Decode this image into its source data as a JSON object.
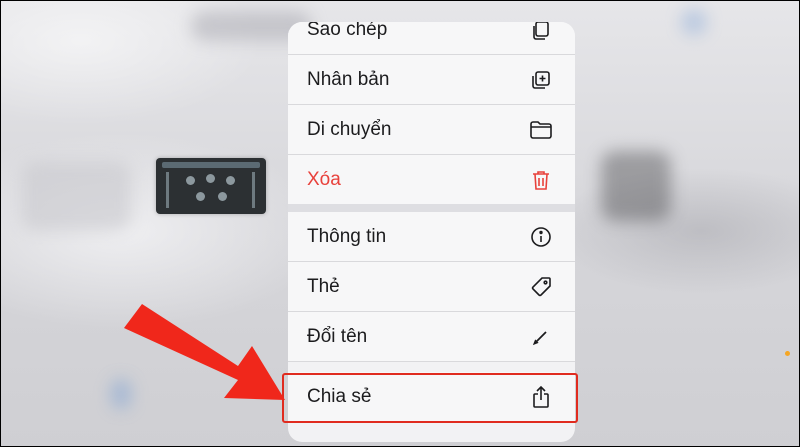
{
  "menu": {
    "items": [
      {
        "label": "Sao chép",
        "icon": "copy-icon"
      },
      {
        "label": "Nhân bản",
        "icon": "duplicate-icon"
      },
      {
        "label": "Di chuyển",
        "icon": "folder-icon"
      },
      {
        "label": "Xóa",
        "icon": "trash-icon",
        "color": "#e8413b"
      },
      {
        "label": "Thông tin",
        "icon": "info-icon"
      },
      {
        "label": "Thẻ",
        "icon": "tag-icon"
      },
      {
        "label": "Đổi tên",
        "icon": "pencil-icon"
      },
      {
        "label": "Chia sẻ",
        "icon": "share-icon"
      }
    ]
  },
  "annotation": {
    "highlight_color": "#e02b1f",
    "highlighted_item": "Chia sẻ"
  }
}
